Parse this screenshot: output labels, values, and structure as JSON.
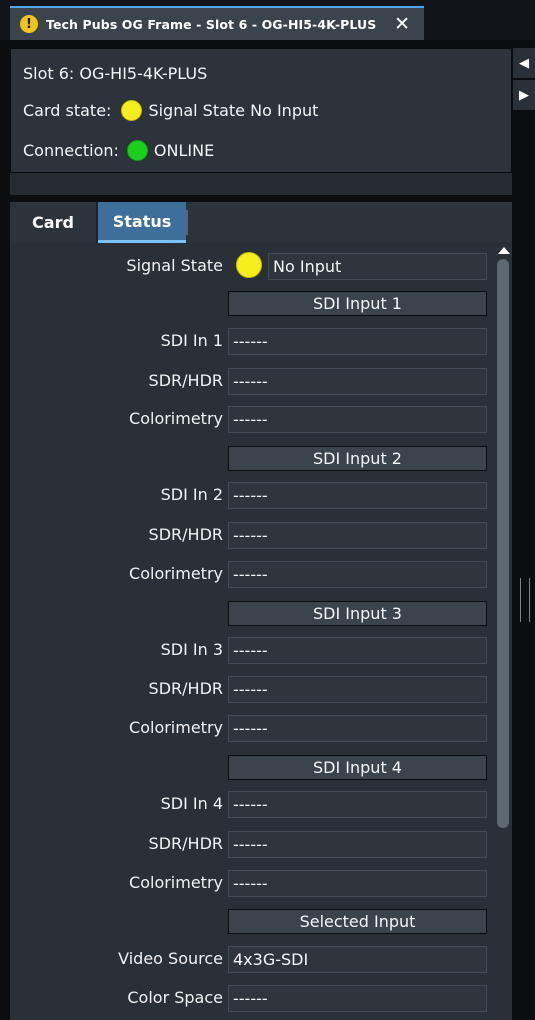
{
  "window": {
    "tab_title": "Tech Pubs OG Frame - Slot 6 - OG-HI5-4K-PLUS",
    "close_glyph": "✕",
    "warning_glyph": "!"
  },
  "info": {
    "slot": "Slot 6: OG-HI5-4K-PLUS",
    "card_state_label": "Card state:",
    "card_state_value": "Signal State No Input",
    "connection_label": "Connection:",
    "connection_value": "ONLINE"
  },
  "tabs": {
    "card": "Card",
    "status": "Status"
  },
  "status": {
    "signal_state_label": "Signal State",
    "signal_state_value": "No Input",
    "sections": [
      {
        "header": "SDI Input 1",
        "rows": [
          {
            "label": "SDI In 1",
            "value": "------"
          },
          {
            "label": "SDR/HDR",
            "value": "------"
          },
          {
            "label": "Colorimetry",
            "value": "------"
          }
        ]
      },
      {
        "header": "SDI Input 2",
        "rows": [
          {
            "label": "SDI In 2",
            "value": "------"
          },
          {
            "label": "SDR/HDR",
            "value": "------"
          },
          {
            "label": "Colorimetry",
            "value": "------"
          }
        ]
      },
      {
        "header": "SDI Input 3",
        "rows": [
          {
            "label": "SDI In 3",
            "value": "------"
          },
          {
            "label": "SDR/HDR",
            "value": "------"
          },
          {
            "label": "Colorimetry",
            "value": "------"
          }
        ]
      },
      {
        "header": "SDI Input 4",
        "rows": [
          {
            "label": "SDI In 4",
            "value": "------"
          },
          {
            "label": "SDR/HDR",
            "value": "------"
          },
          {
            "label": "Colorimetry",
            "value": "------"
          }
        ]
      },
      {
        "header": "Selected Input",
        "rows": [
          {
            "label": "Video Source",
            "value": "4x3G-SDI"
          },
          {
            "label": "Color Space",
            "value": "------"
          }
        ]
      }
    ]
  },
  "colors": {
    "accent": "#4da3ff",
    "active_tab": "#3d6f9a",
    "signal_yellow": "#f6ee1c",
    "online_green": "#19d11a",
    "warning": "#f0c419"
  },
  "icons": {
    "warning": "warning-icon",
    "close": "close-icon",
    "arrow_left": "arrow-left-icon",
    "arrow_right": "arrow-right-icon",
    "scroll_up": "scroll-up-arrow-icon"
  }
}
